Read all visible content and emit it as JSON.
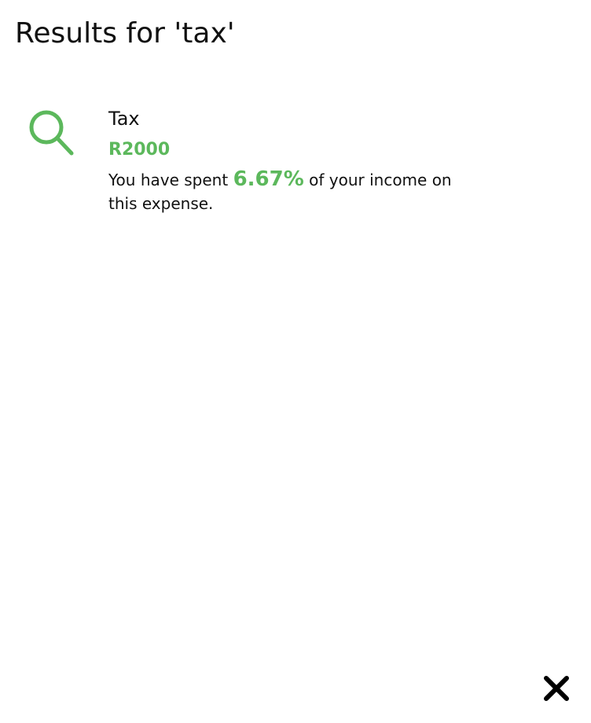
{
  "header": {
    "title": "Results for 'tax'"
  },
  "theme": {
    "accent_color": "#5cb85c",
    "text_color": "#111111"
  },
  "results": [
    {
      "icon": "search-icon",
      "name": "Tax",
      "amount": "R2000",
      "description_prefix": "You have spent",
      "percentage": "6.67%",
      "description_suffix": "of your income on this expense."
    }
  ],
  "close_button": {
    "icon": "close-icon"
  }
}
